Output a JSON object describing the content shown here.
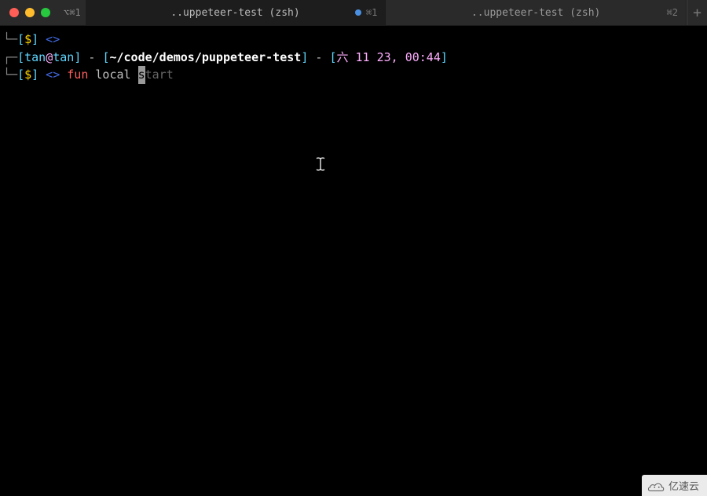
{
  "titlebar": {
    "shortcut_left": "⌥⌘1",
    "tabs": [
      {
        "title": "..uppeteer-test (zsh)",
        "shortcut": "⌘1",
        "has_indicator": true
      },
      {
        "title": "..uppeteer-test (zsh)",
        "shortcut": "⌘2",
        "has_indicator": false
      }
    ],
    "new_tab": "+"
  },
  "prompt1": {
    "tree_top": "└─",
    "open_br": "[",
    "dollar": "$",
    "close_br": "]",
    "angle": " <> "
  },
  "prompt2": {
    "tree_top": "┌─",
    "open_br": "[",
    "user": "tan",
    "at": "@",
    "host": "tan",
    "close_br": "]",
    "dash": " - ",
    "open_br2": "[",
    "path": "~/code/demos/puppeteer-test",
    "close_br2": "]",
    "dash2": " - ",
    "open_br3": "[",
    "date": "六 11 23, 00:44",
    "close_br3": "]"
  },
  "prompt3": {
    "tree_bot": "└─",
    "open_br": "[",
    "dollar": "$",
    "close_br": "]",
    "angle": " <> ",
    "cmd_fun": "fun",
    "space": " ",
    "cmd_local": "local ",
    "cursor_char": "s",
    "suggestion": "tart"
  },
  "watermark": {
    "text": "亿速云"
  }
}
